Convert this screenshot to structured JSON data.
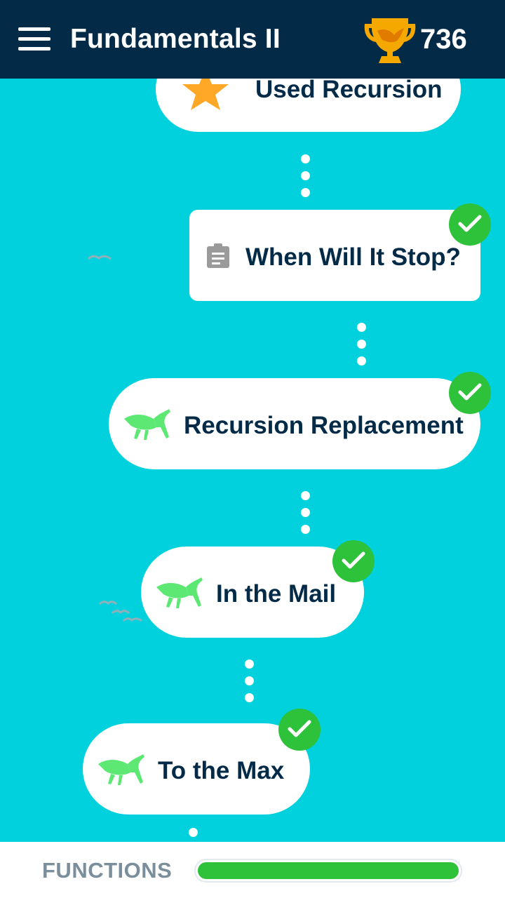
{
  "header": {
    "title": "Fundamentals II",
    "score": "736",
    "menu_icon": "hamburger-menu-icon",
    "trophy_icon": "trophy-icon"
  },
  "path": {
    "items": [
      {
        "label": "Used Recursion",
        "icon": "star-icon",
        "type": "achievement",
        "completed": false
      },
      {
        "label": "When Will It Stop?",
        "icon": "clipboard-icon",
        "type": "quiz",
        "completed": true
      },
      {
        "label": "Recursion Replacement",
        "icon": "grasshopper-icon",
        "type": "lesson",
        "completed": true
      },
      {
        "label": "In the Mail",
        "icon": "grasshopper-icon",
        "type": "lesson",
        "completed": true
      },
      {
        "label": "To the Max",
        "icon": "grasshopper-icon",
        "type": "lesson",
        "completed": true
      }
    ]
  },
  "footer": {
    "section_label": "FUNCTIONS",
    "progress": 1.0
  },
  "colors": {
    "background": "#00d1dd",
    "header": "#032b47",
    "text": "#032b47",
    "check": "#2ec23a",
    "grasshopper": "#5ce873",
    "star": "#ffa726",
    "trophy": "#f5a800"
  }
}
